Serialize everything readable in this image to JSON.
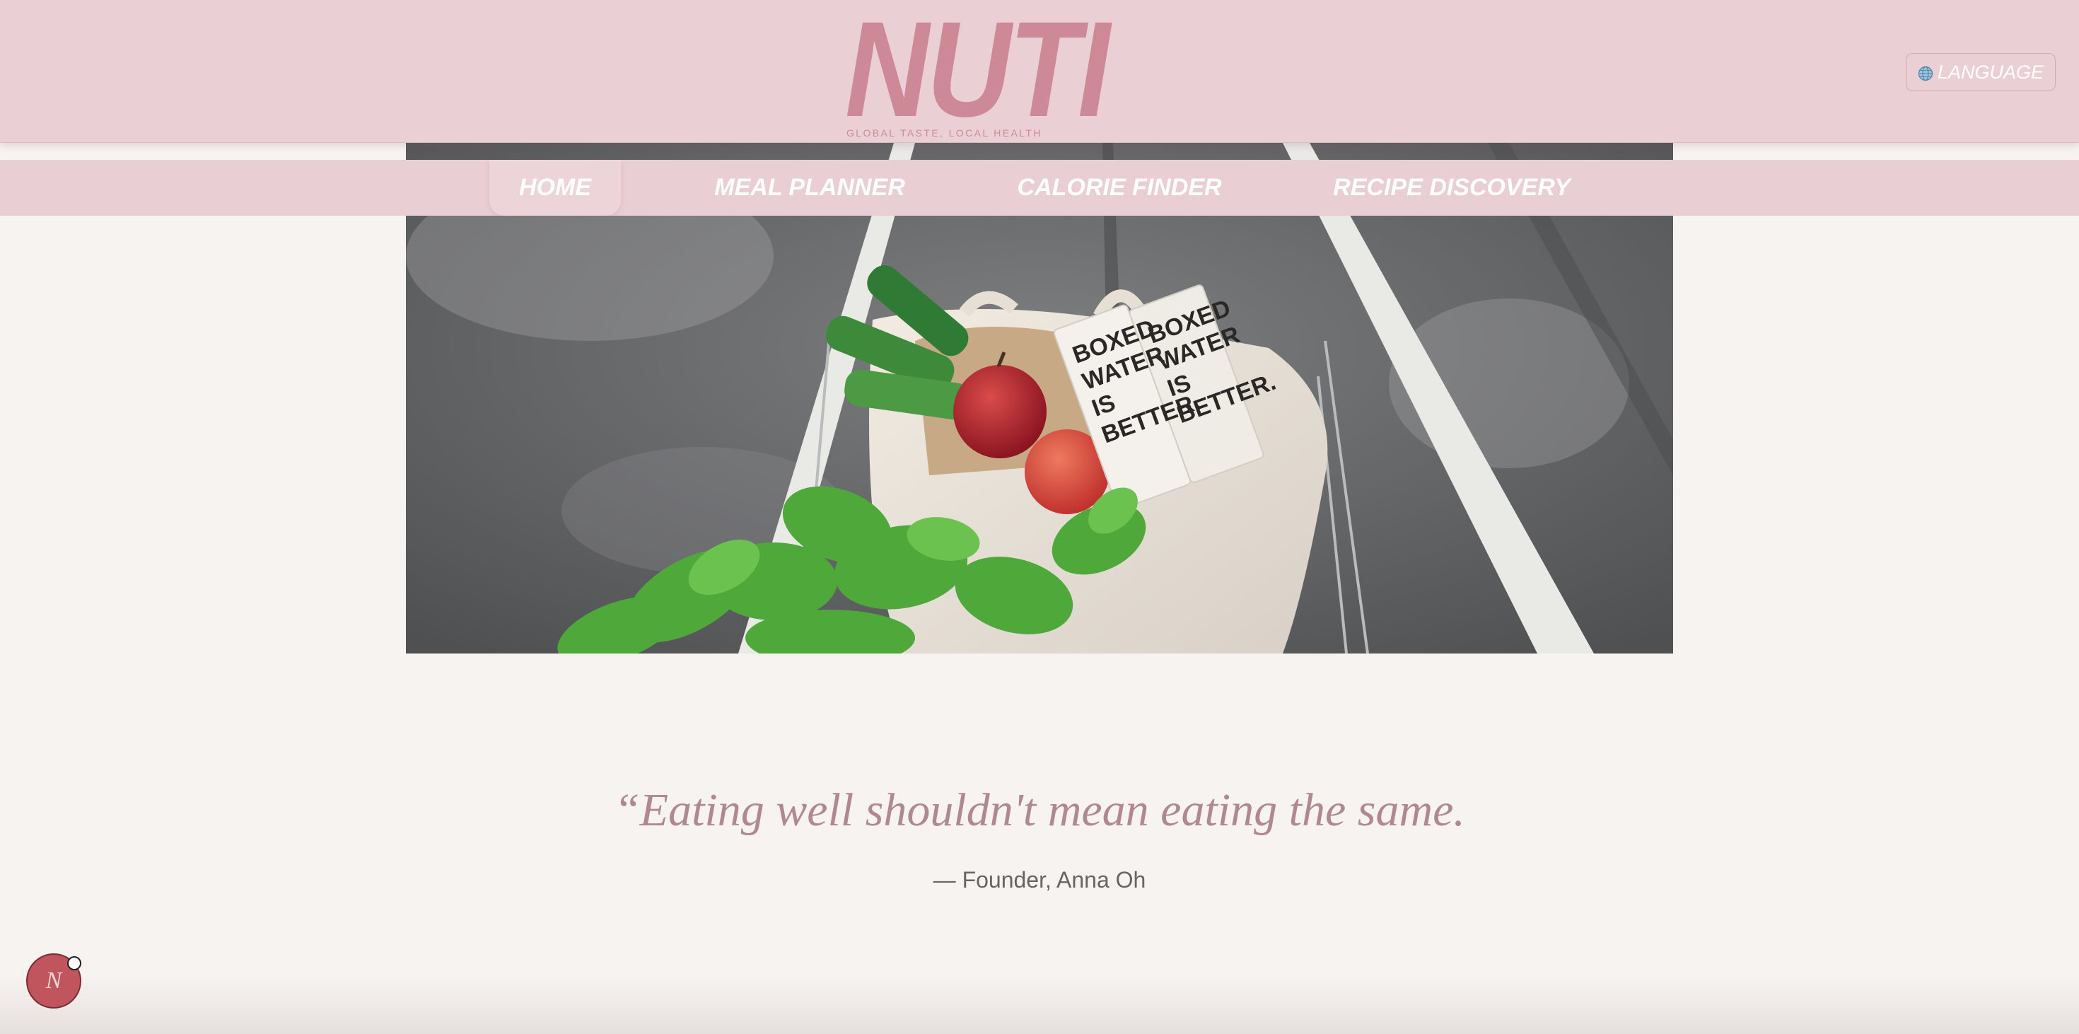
{
  "brand": {
    "logo": "NUTI",
    "tagline": "GLOBAL TASTE, LOCAL HEALTH",
    "color": "#cd8a96"
  },
  "header": {
    "language_button": {
      "label": "LANGUAGE",
      "icon": "globe-icon"
    }
  },
  "nav": {
    "items": [
      {
        "label": "HOME",
        "active": true
      },
      {
        "label": "MEAL PLANNER",
        "active": false
      },
      {
        "label": "CALORIE FINDER",
        "active": false
      },
      {
        "label": "RECIPE DISCOVERY",
        "active": false
      }
    ]
  },
  "hero": {
    "carton_text": [
      "BOXED",
      "WATER",
      "IS",
      "BETTER."
    ]
  },
  "quote": {
    "text": "“Eating well shouldn't mean eating the same.",
    "attribution": "— Founder, Anna Oh"
  },
  "badge": {
    "letter": "N"
  },
  "colors": {
    "header_bg": "#ead0d5",
    "page_bg": "#f7f3f1",
    "quote": "#b08990",
    "badge": "#c0555d"
  }
}
